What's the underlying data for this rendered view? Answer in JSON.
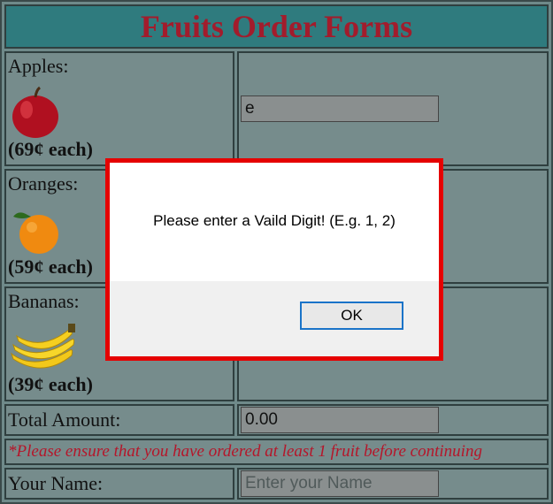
{
  "form": {
    "title": "Fruits Order Forms",
    "fruits": [
      {
        "name": "Apples:",
        "price": "(69¢ each)",
        "icon": "apple-icon",
        "quantity_value": "e"
      },
      {
        "name": "Oranges:",
        "price": "(59¢ each)",
        "icon": "orange-icon"
      },
      {
        "name": "Bananas:",
        "price": "(39¢ each)",
        "icon": "banana-icon"
      }
    ],
    "total_label": "Total Amount:",
    "total_value": "0.00",
    "notice": "*Please ensure that you have ordered at least 1 fruit before continuing",
    "name_label": "Your Name:",
    "name_placeholder": "Enter your Name"
  },
  "dialog": {
    "message": "Please enter a Vaild Digit! (E.g. 1, 2)",
    "ok_label": "OK",
    "highlight_color": "#e50000"
  },
  "colors": {
    "title_bg": "#2f7b7e",
    "title_text": "#a21c2c",
    "notice_text": "#b5162a",
    "cell_bg": "#768c8c"
  }
}
